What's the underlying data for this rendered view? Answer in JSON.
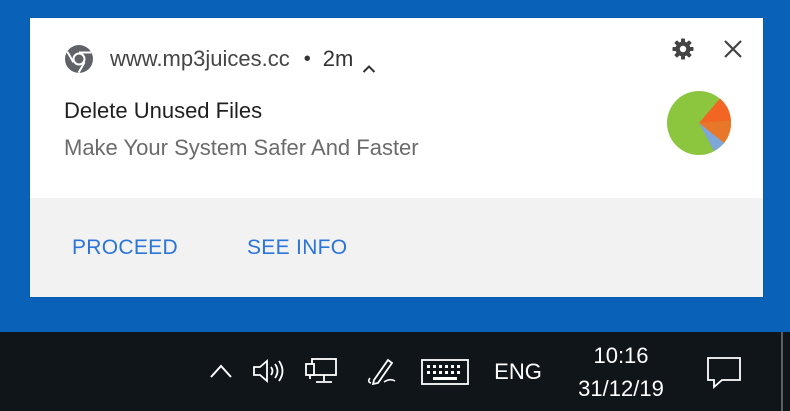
{
  "notification": {
    "source": "www.mp3juices.cc",
    "separator": "•",
    "time": "2m",
    "title": "Delete Unused Files",
    "message": "Make Your System Safer And Faster",
    "actions": [
      {
        "label": "PROCEED"
      },
      {
        "label": "SEE INFO"
      }
    ],
    "icons": {
      "browser": "chrome-icon",
      "collapse": "chevron-up-icon",
      "settings": "gear-icon",
      "close": "close-icon",
      "image": "pie-chart-icon"
    },
    "colors": {
      "action_text": "#2b74d8",
      "card_bg": "#ffffff",
      "actions_bg": "#f2f2f2"
    }
  },
  "taskbar": {
    "language": "ENG",
    "clock": {
      "time": "10:16",
      "date": "31/12/19"
    },
    "icons": {
      "overflow": "chevron-up-icon",
      "volume": "speaker-icon",
      "network": "network-icon",
      "pen": "pen-icon",
      "touch_keyboard": "keyboard-icon",
      "action_center": "notification-icon"
    },
    "colors": {
      "background": "#10151a",
      "desktop": "#0a62b8"
    }
  }
}
